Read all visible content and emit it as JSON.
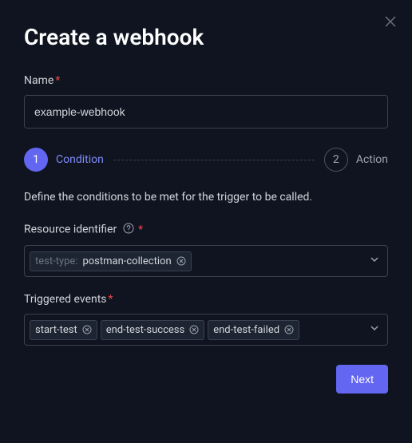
{
  "modal": {
    "title": "Create a webhook",
    "close_label": "Close"
  },
  "name_field": {
    "label": "Name",
    "value": "example-webhook"
  },
  "steps": {
    "step1": {
      "num": "1",
      "label": "Condition"
    },
    "step2": {
      "num": "2",
      "label": "Action"
    }
  },
  "condition": {
    "description": "Define the conditions to be met for the trigger to be called.",
    "resource": {
      "label": "Resource identifier",
      "tags": [
        {
          "prefix": "test-type:",
          "value": "postman-collection"
        }
      ]
    },
    "events": {
      "label": "Triggered events",
      "tags": [
        {
          "value": "start-test"
        },
        {
          "value": "end-test-success"
        },
        {
          "value": "end-test-failed"
        }
      ]
    }
  },
  "footer": {
    "next_label": "Next"
  }
}
